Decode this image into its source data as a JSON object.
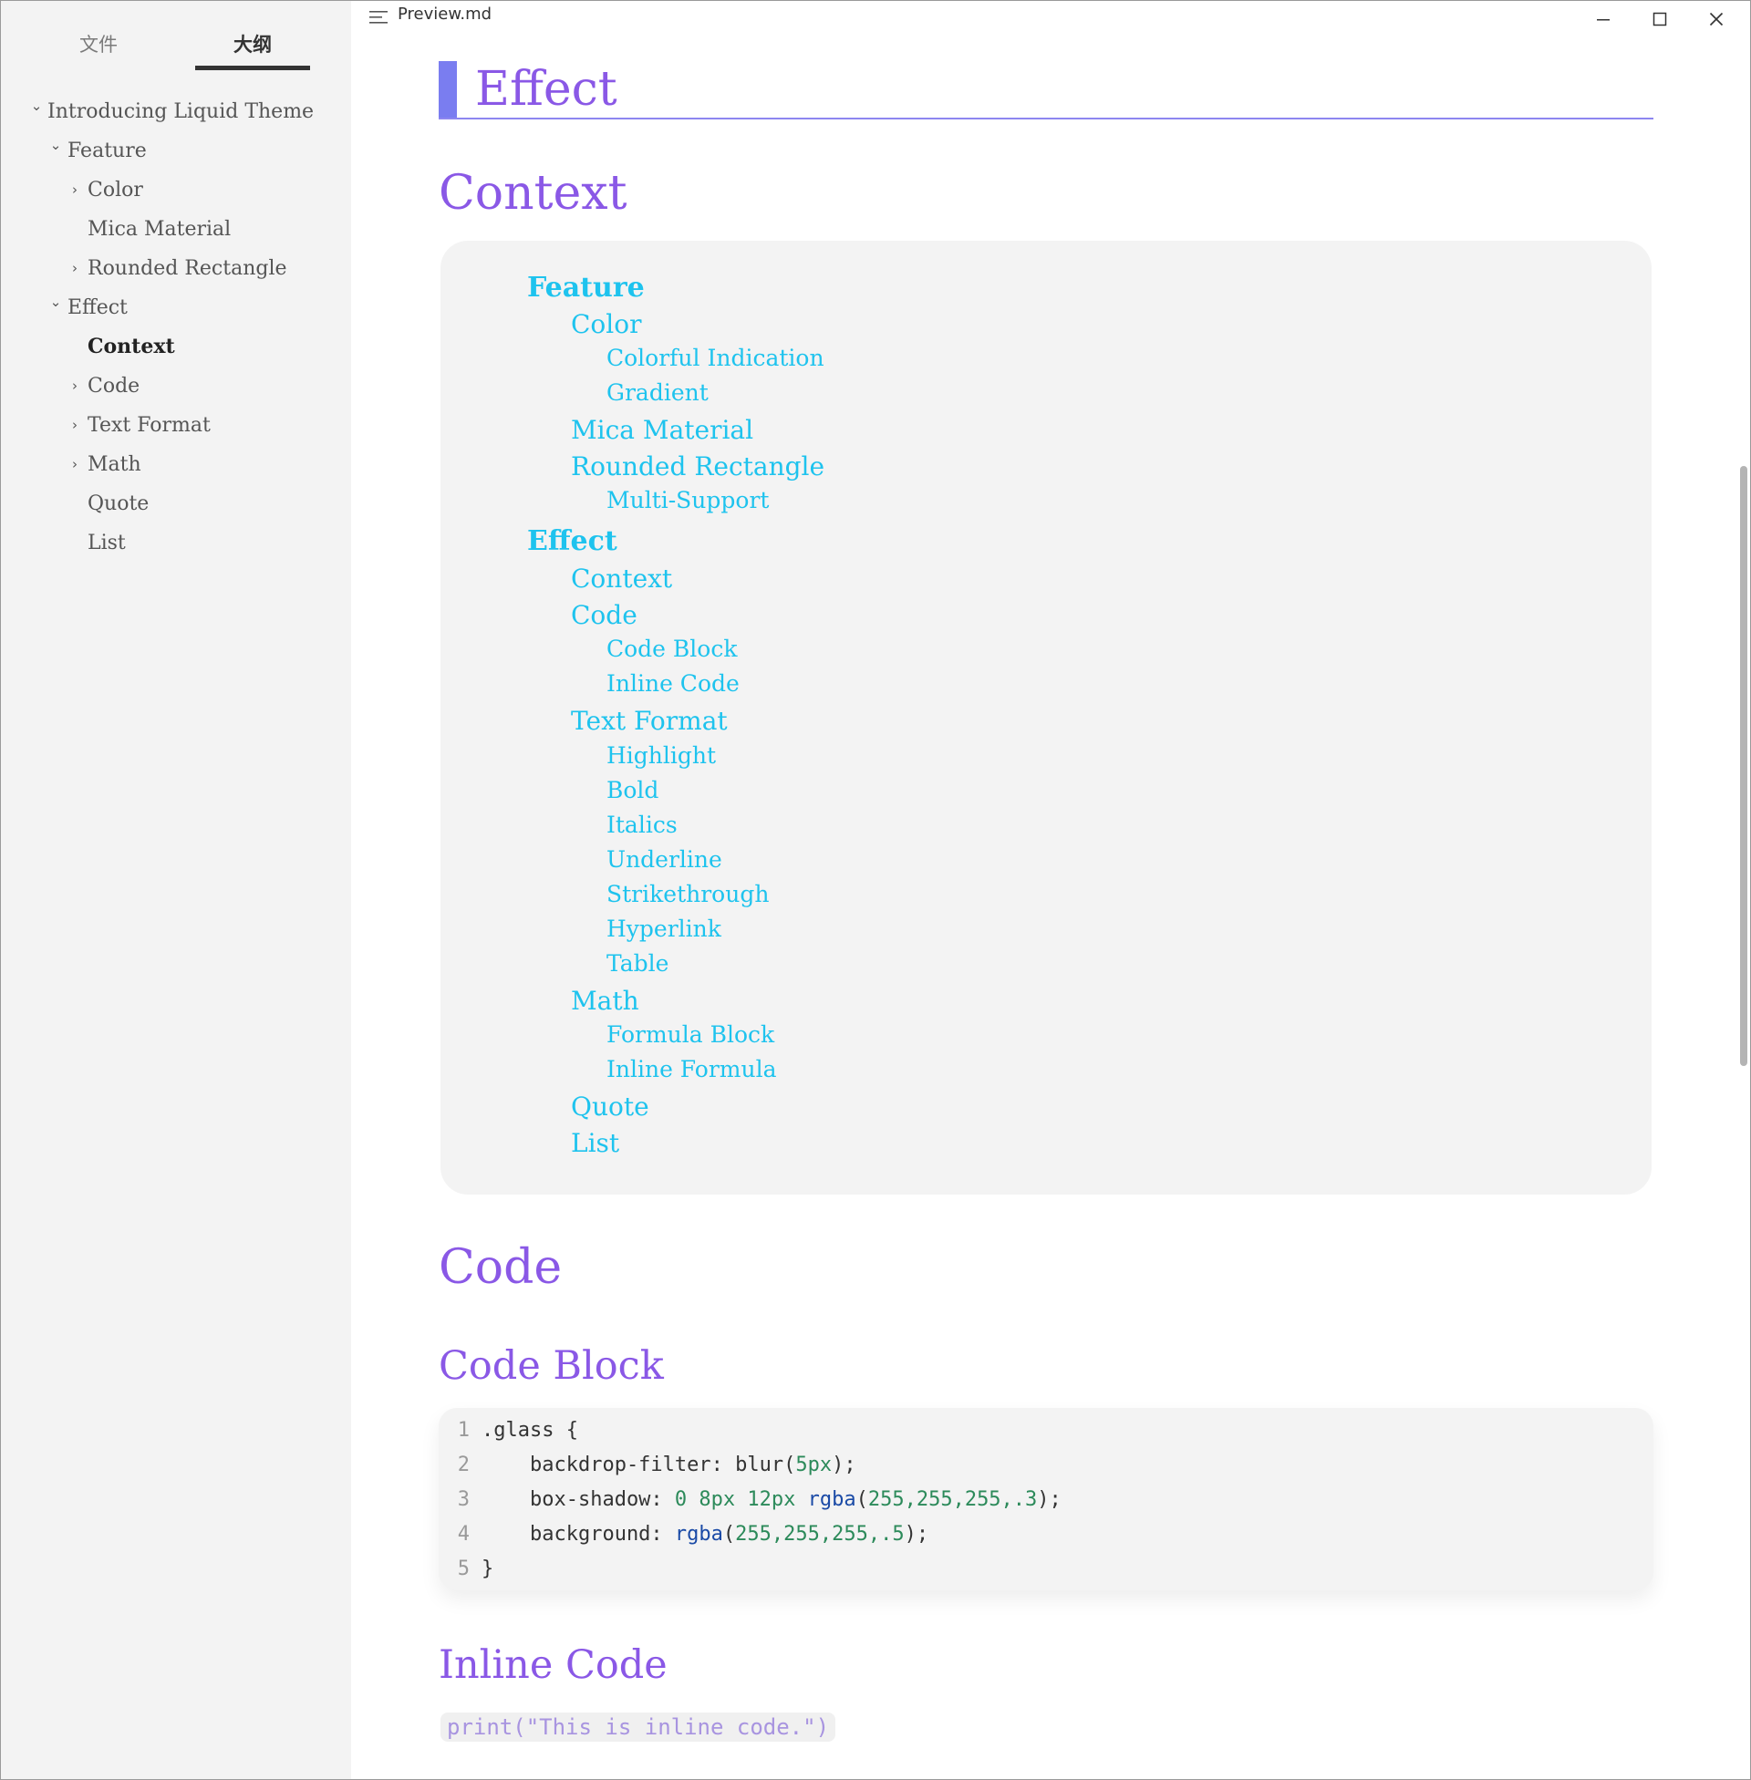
{
  "window": {
    "file_title": "Preview.md",
    "colors": {
      "heading": "#8a58e6",
      "toc_link": "#1ec3ee",
      "h1_bar": "#7a7df0",
      "sidebar_bg": "#f3f3f3"
    }
  },
  "sidebar": {
    "tabs": [
      {
        "label": "文件",
        "active": false
      },
      {
        "label": "大纲",
        "active": true
      }
    ],
    "outline": [
      {
        "label": "Introducing Liquid Theme",
        "level": 1,
        "expand": "open"
      },
      {
        "label": "Feature",
        "level": 2,
        "expand": "open"
      },
      {
        "label": "Color",
        "level": 3,
        "expand": "closed"
      },
      {
        "label": "Mica Material",
        "level": 3,
        "expand": "none"
      },
      {
        "label": "Rounded Rectangle",
        "level": 3,
        "expand": "closed"
      },
      {
        "label": "Effect",
        "level": 2,
        "expand": "open"
      },
      {
        "label": "Context",
        "level": 3,
        "expand": "none",
        "active": true
      },
      {
        "label": "Code",
        "level": 3,
        "expand": "closed"
      },
      {
        "label": "Text Format",
        "level": 3,
        "expand": "closed"
      },
      {
        "label": "Math",
        "level": 3,
        "expand": "closed"
      },
      {
        "label": "Quote",
        "level": 3,
        "expand": "none"
      },
      {
        "label": "List",
        "level": 3,
        "expand": "none"
      }
    ]
  },
  "content": {
    "h1": "Effect",
    "h2_context": "Context",
    "toc": [
      {
        "label": "Feature",
        "level": 1
      },
      {
        "label": "Color",
        "level": 2
      },
      {
        "label": "Colorful Indication",
        "level": 3
      },
      {
        "label": "Gradient",
        "level": 3
      },
      {
        "label": "Mica Material",
        "level": 2
      },
      {
        "label": "Rounded Rectangle",
        "level": 2
      },
      {
        "label": "Multi-Support",
        "level": 3
      },
      {
        "label": "Effect",
        "level": 1
      },
      {
        "label": "Context",
        "level": 2
      },
      {
        "label": "Code",
        "level": 2
      },
      {
        "label": "Code Block",
        "level": 3
      },
      {
        "label": "Inline Code",
        "level": 3
      },
      {
        "label": "Text Format",
        "level": 2
      },
      {
        "label": "Highlight",
        "level": 3
      },
      {
        "label": "Bold",
        "level": 3
      },
      {
        "label": "Italics",
        "level": 3
      },
      {
        "label": "Underline",
        "level": 3
      },
      {
        "label": "Strikethrough",
        "level": 3
      },
      {
        "label": "Hyperlink",
        "level": 3
      },
      {
        "label": "Table",
        "level": 3
      },
      {
        "label": "Math",
        "level": 2
      },
      {
        "label": "Formula Block",
        "level": 3
      },
      {
        "label": "Inline Formula",
        "level": 3
      },
      {
        "label": "Quote",
        "level": 2
      },
      {
        "label": "List",
        "level": 2
      }
    ],
    "h2_code": "Code",
    "h3_code_block": "Code Block",
    "code_lines": [
      {
        "n": "1",
        "tokens": [
          {
            "t": ".glass {",
            "k": "plain"
          }
        ]
      },
      {
        "n": "2",
        "tokens": [
          {
            "t": "    backdrop-filter: ",
            "k": "plain"
          },
          {
            "t": "blur",
            "k": "plain"
          },
          {
            "t": "(",
            "k": "plain"
          },
          {
            "t": "5px",
            "k": "num"
          },
          {
            "t": ");",
            "k": "plain"
          }
        ]
      },
      {
        "n": "3",
        "tokens": [
          {
            "t": "    box-shadow: ",
            "k": "plain"
          },
          {
            "t": "0 8px 12px",
            "k": "num"
          },
          {
            "t": " ",
            "k": "plain"
          },
          {
            "t": "rgba",
            "k": "fn"
          },
          {
            "t": "(",
            "k": "plain"
          },
          {
            "t": "255,255,255,.3",
            "k": "num"
          },
          {
            "t": ");",
            "k": "plain"
          }
        ]
      },
      {
        "n": "4",
        "tokens": [
          {
            "t": "    background: ",
            "k": "plain"
          },
          {
            "t": "rgba",
            "k": "fn"
          },
          {
            "t": "(",
            "k": "plain"
          },
          {
            "t": "255,255,255,.5",
            "k": "num"
          },
          {
            "t": ");",
            "k": "plain"
          }
        ]
      },
      {
        "n": "5",
        "tokens": [
          {
            "t": "}",
            "k": "plain"
          }
        ]
      }
    ],
    "h3_inline_code": "Inline Code",
    "inline_code": "print(\"This is inline code.\")"
  }
}
